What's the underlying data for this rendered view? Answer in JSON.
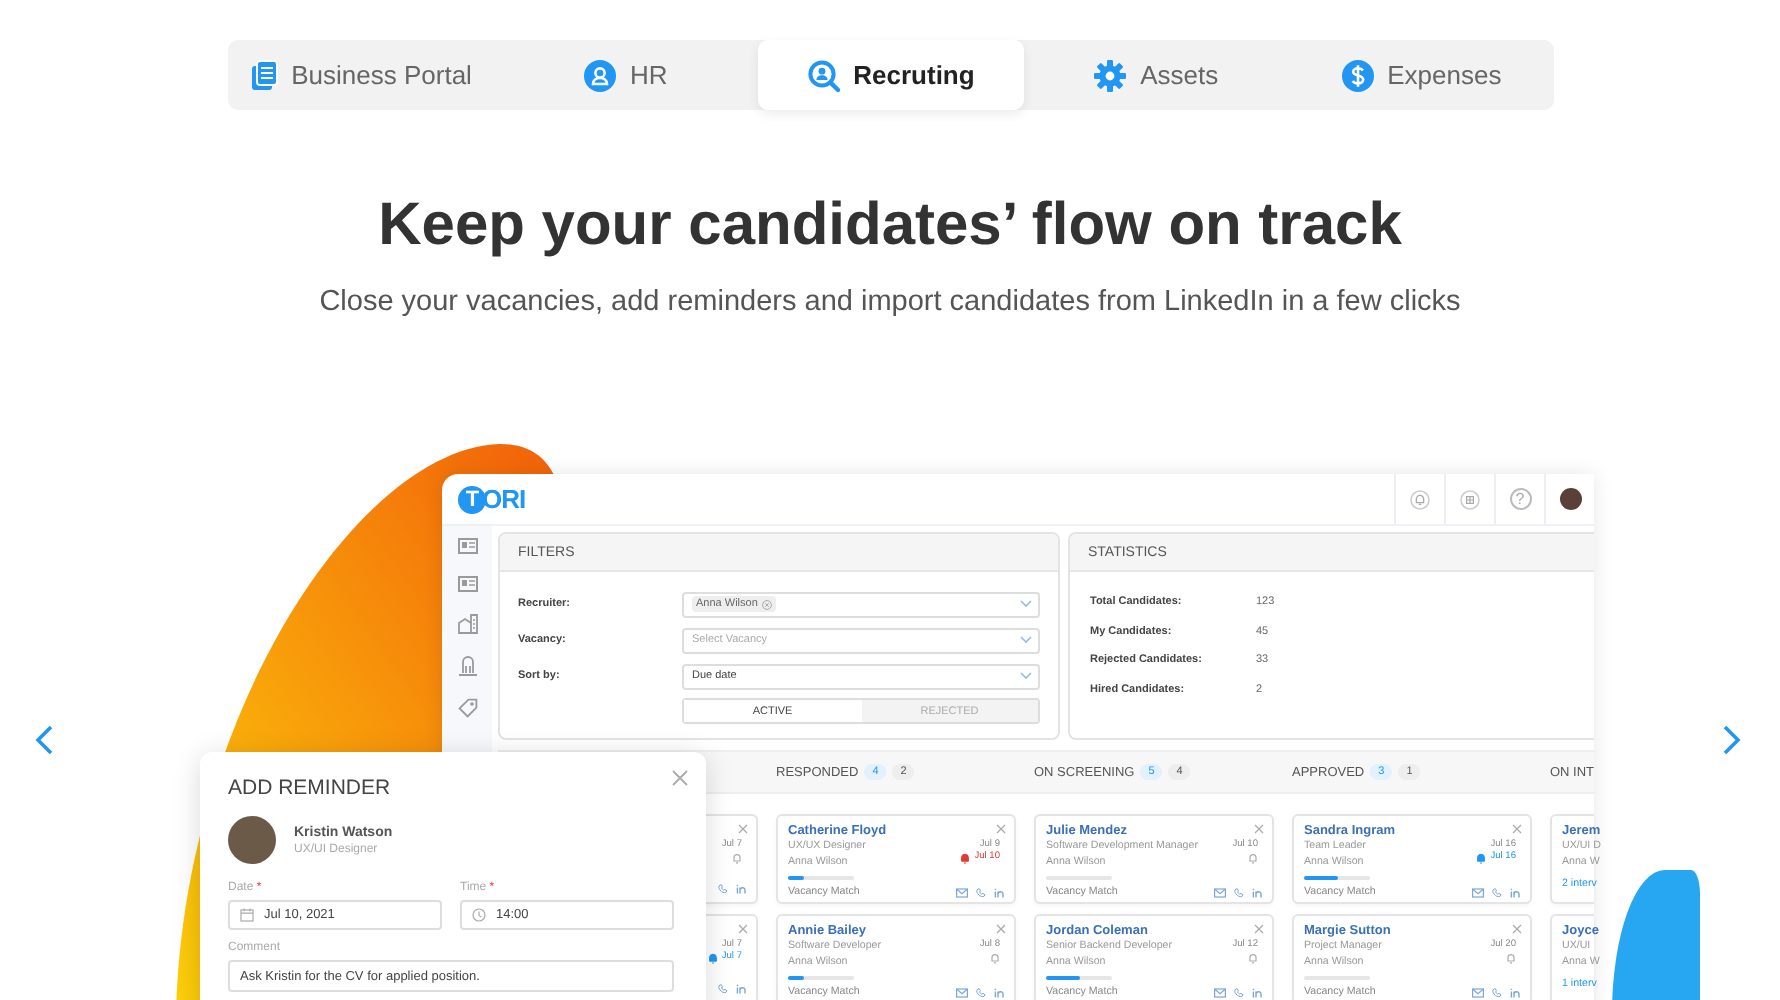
{
  "tabs": [
    {
      "label": "Business Portal",
      "selected": false
    },
    {
      "label": "HR",
      "selected": false
    },
    {
      "label": "Recruting",
      "selected": true
    },
    {
      "label": "Assets",
      "selected": false
    },
    {
      "label": "Expenses",
      "selected": false
    }
  ],
  "hero": {
    "title": "Keep your candidates’ flow on track",
    "subtitle": "Close your vacancies, add reminders and import candidates from LinkedIn in a few clicks"
  },
  "app": {
    "logo": "TORI",
    "help": "?",
    "filters": {
      "title": "FILTERS",
      "rows": [
        {
          "label": "Recruiter:",
          "kind": "tag",
          "value": "Anna Wilson"
        },
        {
          "label": "Vacancy:",
          "kind": "select",
          "placeholder": "Select Vacancy"
        },
        {
          "label": "Sort by:",
          "kind": "select",
          "value": "Due date"
        }
      ],
      "toggle": [
        {
          "label": "ACTIVE",
          "selected": true
        },
        {
          "label": "REJECTED",
          "selected": false
        }
      ]
    },
    "statistics": {
      "title": "STATISTICS",
      "rows": [
        {
          "label": "Total Candidates:",
          "value": "123"
        },
        {
          "label": "My Candidates:",
          "value": "45"
        },
        {
          "label": "Rejected Candidates:",
          "value": "33"
        },
        {
          "label": "Hired Candidates:",
          "value": "2"
        }
      ]
    },
    "board": [
      {
        "cards": [
          {
            "kind": "end",
            "date": "Jul 7"
          },
          {
            "kind": "end",
            "date": "Jul 7",
            "reminder": {
              "date": "Jul 7",
              "overdue": false
            }
          }
        ]
      },
      {
        "title": "RESPONDED",
        "count": "4",
        "count_2": "2",
        "cards": [
          {
            "kind": "full",
            "name": "Catherine Floyd",
            "role": "UX/UX Designer",
            "recruiter": "Anna Wilson",
            "date": "Jul 9",
            "reminder": {
              "date": "Jul 10",
              "overdue": true
            },
            "level": 0.25,
            "footer": "Vacancy Match"
          },
          {
            "kind": "full",
            "name": "Annie Bailey",
            "role": "Software Developer",
            "recruiter": "Anna Wilson",
            "date": "Jul 8",
            "level": 0.25,
            "footer": "Vacancy Match"
          }
        ]
      },
      {
        "title": "ON SCREENING",
        "count": "5",
        "count_2": "4",
        "cards": [
          {
            "kind": "full",
            "name": "Julie Mendez",
            "role": "Software Development Manager",
            "recruiter": "Anna Wilson",
            "date": "Jul 10",
            "level": 0,
            "footer": "Vacancy Match"
          },
          {
            "kind": "full",
            "name": "Jordan Coleman",
            "role": "Senior Backend Developer",
            "recruiter": "Anna Wilson",
            "date": "Jul 12",
            "level": 0.5,
            "footer": "Vacancy Match"
          }
        ]
      },
      {
        "title": "APPROVED",
        "count": "3",
        "count_2": "1",
        "cards": [
          {
            "kind": "full",
            "name": "Sandra Ingram",
            "role": "Team Leader",
            "recruiter": "Anna Wilson",
            "date": "Jul 16",
            "reminder": {
              "date": "Jul 16",
              "overdue": false
            },
            "level": 0.5,
            "footer": "Vacancy Match"
          },
          {
            "kind": "full",
            "name": "Margie Sutton",
            "role": "Project Manager",
            "recruiter": "Anna Wilson",
            "date": "Jul 20",
            "level": 0,
            "footer": "Vacancy Match"
          }
        ]
      },
      {
        "title": "ON INT",
        "cards": [
          {
            "kind": "start",
            "name": "Jerem",
            "role": "UX/UI D",
            "recruiter": "Anna W",
            "footer": "2 interv"
          },
          {
            "kind": "start",
            "name": "Joyce",
            "role": "UX/UI",
            "recruiter": "Anna W",
            "footer": "1 interv"
          }
        ]
      }
    ]
  },
  "reminder": {
    "title": "ADD REMINDER",
    "person": {
      "name": "Kristin Watson",
      "role": "UX/UI Designer"
    },
    "fields": [
      {
        "kind": "date",
        "label": "Date",
        "marker": "*",
        "value": "Jul 10, 2021"
      },
      {
        "kind": "time",
        "label": "Time",
        "marker": "*",
        "value": "14:00"
      },
      {
        "kind": "comment",
        "label": "Comment",
        "value": "Ask Kristin for the CV for applied position."
      }
    ]
  }
}
